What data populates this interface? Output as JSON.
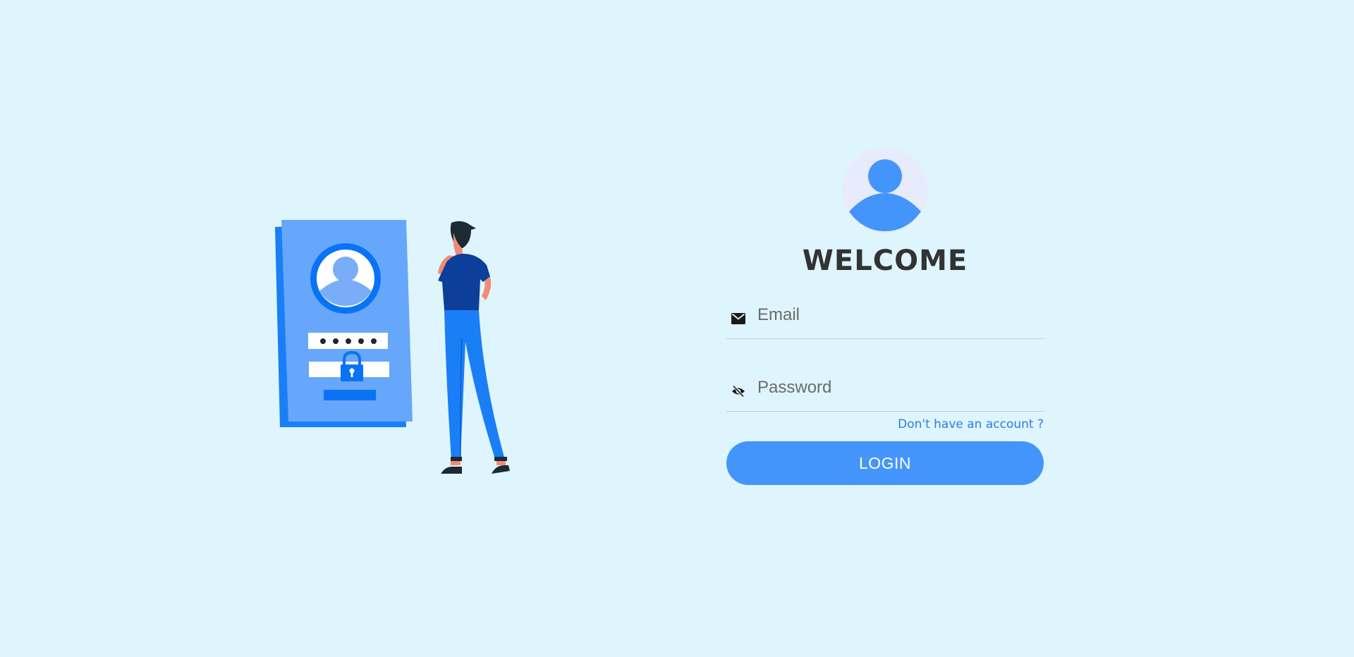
{
  "colors": {
    "background": "#dff5fe",
    "accent": "#4395fb",
    "link": "#2d7be0",
    "heading": "#333333"
  },
  "illustration": {
    "icons": [
      "phone-login-card",
      "person-thinking",
      "padlock-icon"
    ]
  },
  "login": {
    "avatar_icon": "user-avatar-icon",
    "title": "WELCOME",
    "email": {
      "icon": "envelope-icon",
      "placeholder": "Email",
      "value": ""
    },
    "password": {
      "icon": "eye-slash-icon",
      "placeholder": "Password",
      "value": ""
    },
    "signup_link": "Don't have an account ?",
    "button_label": "LOGIN"
  }
}
